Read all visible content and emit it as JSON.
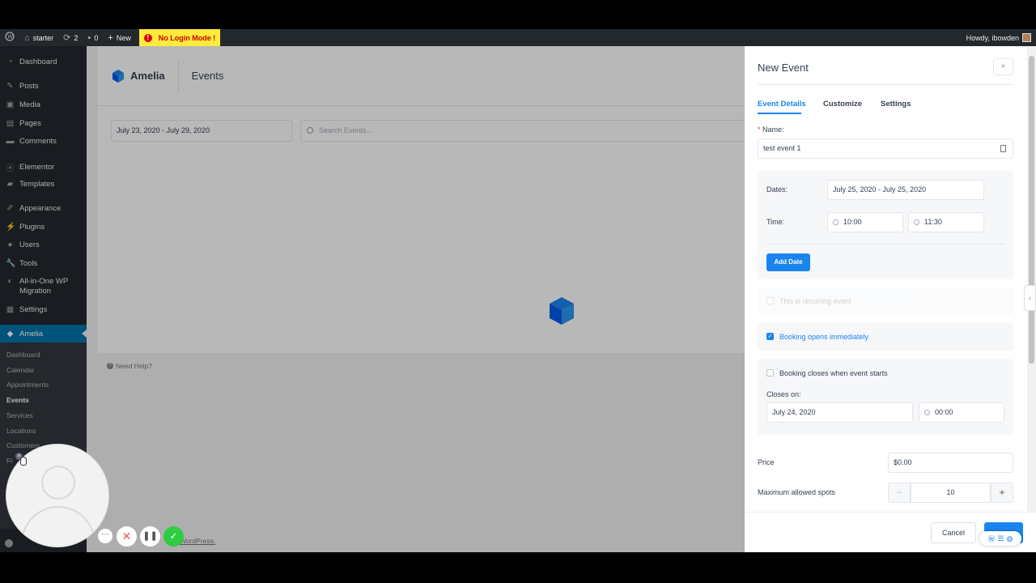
{
  "adminbar": {
    "site_name": "starter",
    "updates_count": "2",
    "comments_count": "0",
    "new_label": "New",
    "no_login_label": "No Login Mode !",
    "howdy": "Howdy, ibowden"
  },
  "sidebar": {
    "items": [
      {
        "label": "Dashboard",
        "icon": "dashboard-icon"
      },
      {
        "label": "Posts",
        "icon": "pin-icon"
      },
      {
        "label": "Media",
        "icon": "media-icon"
      },
      {
        "label": "Pages",
        "icon": "page-icon"
      },
      {
        "label": "Comments",
        "icon": "comment-icon"
      },
      {
        "label": "Elementor",
        "icon": "elementor-icon"
      },
      {
        "label": "Templates",
        "icon": "folder-icon"
      },
      {
        "label": "Appearance",
        "icon": "brush-icon"
      },
      {
        "label": "Plugins",
        "icon": "plug-icon"
      },
      {
        "label": "Users",
        "icon": "user-icon"
      },
      {
        "label": "Tools",
        "icon": "wrench-icon"
      },
      {
        "label": "All-in-One WP Migration",
        "icon": "migration-icon"
      },
      {
        "label": "Settings",
        "icon": "settings-icon"
      },
      {
        "label": "Amelia",
        "icon": "amelia-icon"
      }
    ],
    "submenu": [
      "Dashboard",
      "Calendar",
      "Appointments",
      "Events",
      "Services",
      "Locations",
      "Customers",
      "Fi"
    ],
    "current_submenu": "Events"
  },
  "amelia": {
    "logo": "Amelia",
    "page_title": "Events",
    "date_range": "July 23, 2020 - July 29, 2020",
    "search_placeholder": "Search Events...",
    "need_help": "Need Help?",
    "footer_fragment": "WordPress."
  },
  "drawer": {
    "title": "New Event",
    "close": "×",
    "tabs": [
      "Event Details",
      "Customize",
      "Settings"
    ],
    "active_tab": "Event Details",
    "name_label": "Name:",
    "name_value": "test event 1",
    "dates_label": "Dates:",
    "dates_value": "July 25, 2020 - July 25, 2020",
    "time_label": "Time:",
    "time_start": "10:00",
    "time_end": "11:30",
    "add_date": "Add Date",
    "recurring_label": "This is recurring event",
    "recurring_checked": false,
    "booking_opens_label": "Booking opens immediately",
    "booking_opens_checked": true,
    "booking_closes_label": "Booking closes when event starts",
    "booking_closes_checked": false,
    "closes_on_label": "Closes on:",
    "closes_on_date": "July 24, 2020",
    "closes_on_time": "00:00",
    "price_label": "Price",
    "price_value": "$0.00",
    "max_spots_label": "Maximum allowed spots",
    "max_spots_value": "10",
    "cancel": "Cancel"
  },
  "colors": {
    "accent": "#1a84ee",
    "wp_dark": "#23282d",
    "wp_blue": "#0073aa",
    "nologin_bg": "#ffeb3b"
  }
}
